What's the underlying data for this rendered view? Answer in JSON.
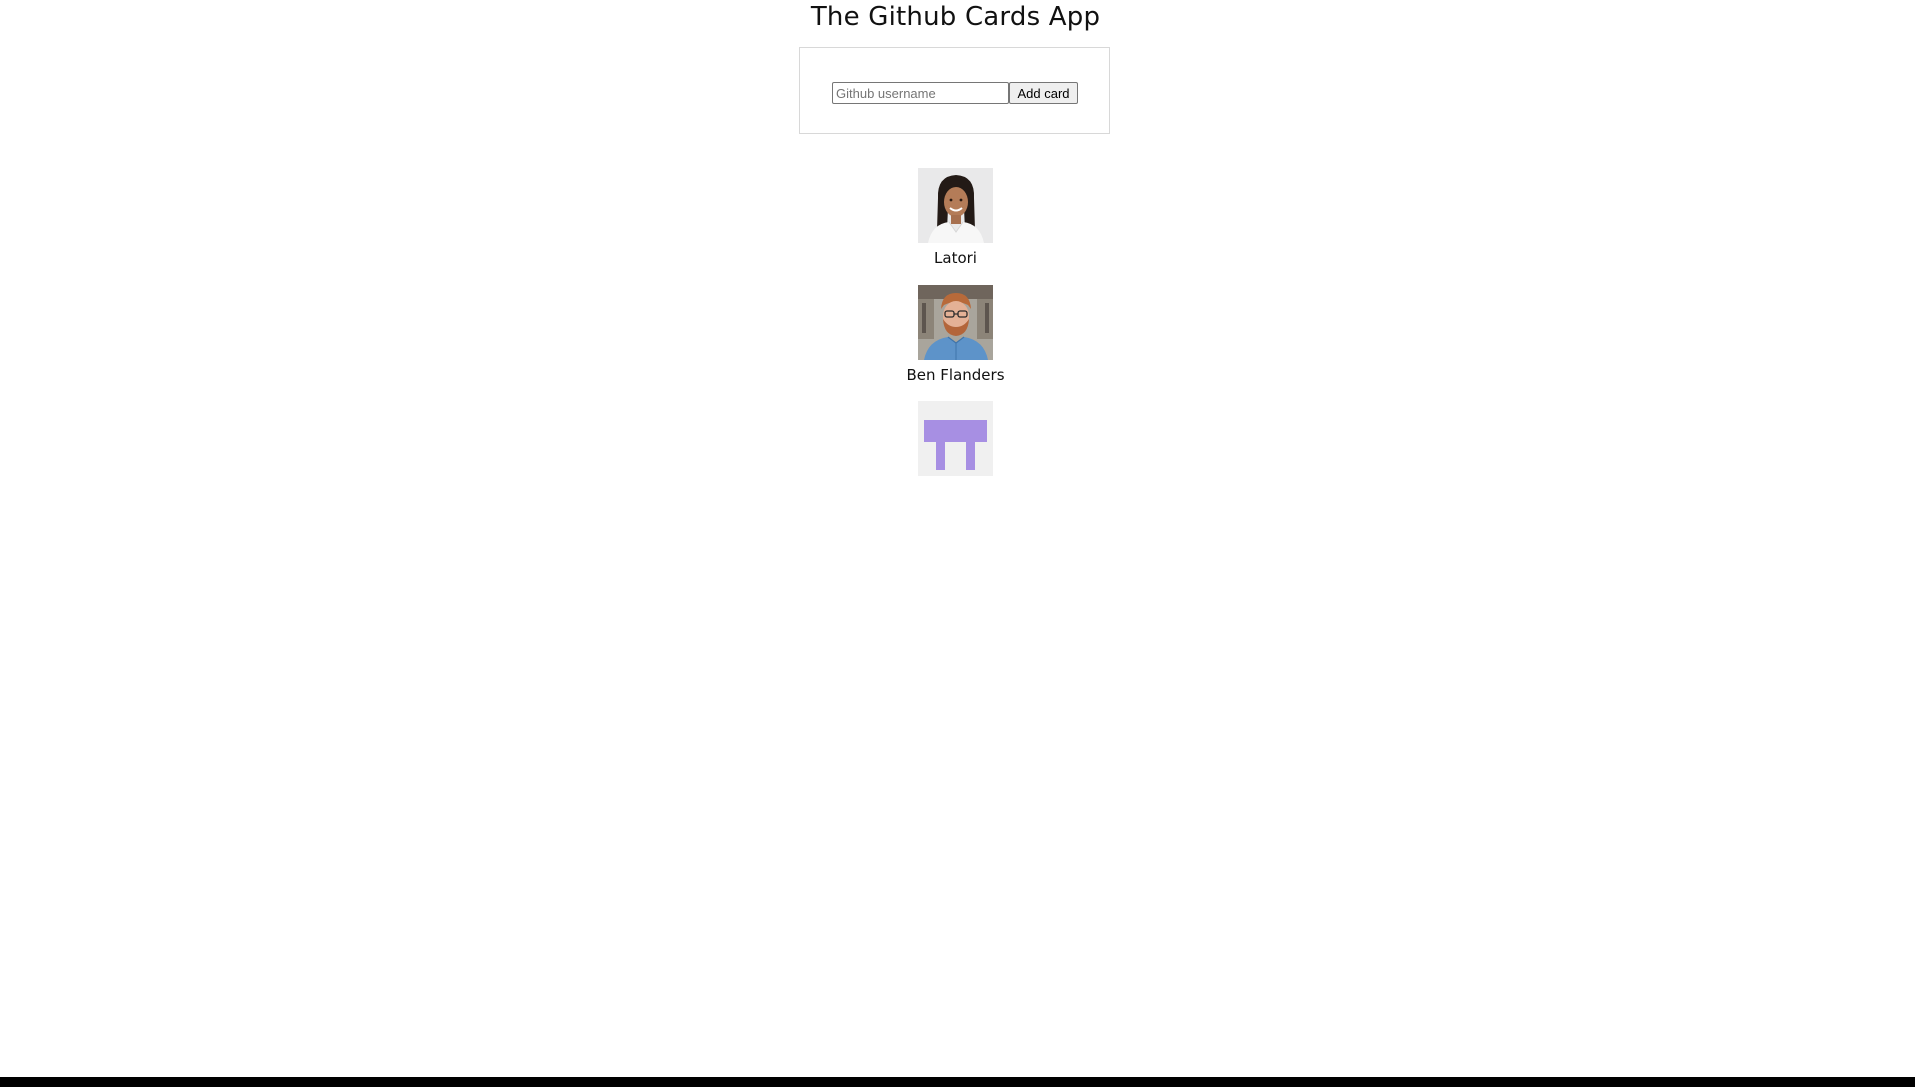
{
  "header": {
    "title": "The Github Cards App"
  },
  "form": {
    "input_value": "",
    "input_placeholder": "Github username",
    "submit_label": "Add card"
  },
  "cards": [
    {
      "name": "Latori",
      "avatar": "avatar-photo-woman"
    },
    {
      "name": "Ben Flanders",
      "avatar": "avatar-photo-man"
    },
    {
      "name": "",
      "avatar": "identicon-purple"
    }
  ],
  "colors": {
    "identicon": "#a78fe3",
    "identicon_bg": "#f0f0f0"
  }
}
